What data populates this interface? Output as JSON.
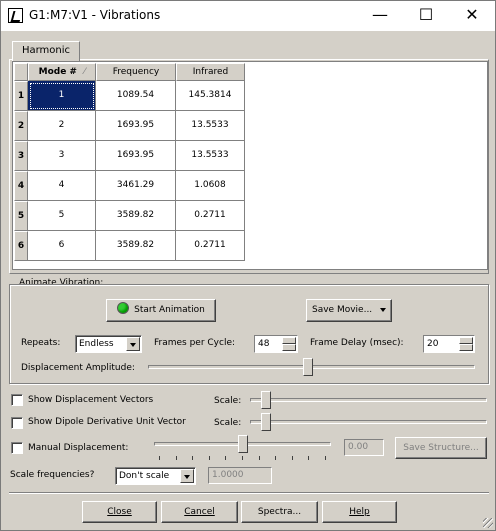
{
  "window": {
    "title": "G1:M7:V1 - Vibrations",
    "minimize": "—",
    "maximize": "☐",
    "close": "✕"
  },
  "tab": {
    "label": "Harmonic"
  },
  "table": {
    "headers": [
      "Mode #",
      "Frequency",
      "Infrared"
    ],
    "sort_indicator": "⁄",
    "rows": [
      {
        "num": "1",
        "mode": "1",
        "frequency": "1089.54",
        "infrared": "145.3814"
      },
      {
        "num": "2",
        "mode": "2",
        "frequency": "1693.95",
        "infrared": "13.5533"
      },
      {
        "num": "3",
        "mode": "3",
        "frequency": "1693.95",
        "infrared": "13.5533"
      },
      {
        "num": "4",
        "mode": "4",
        "frequency": "3461.29",
        "infrared": "1.0608"
      },
      {
        "num": "5",
        "mode": "5",
        "frequency": "3589.82",
        "infrared": "0.2711"
      },
      {
        "num": "6",
        "mode": "6",
        "frequency": "3589.82",
        "infrared": "0.2711"
      }
    ],
    "selected_row": 1
  },
  "animate": {
    "group_label": "Animate Vibration:",
    "start_button": "Start Animation",
    "save_movie_button": "Save Movie...",
    "repeats_label": "Repeats:",
    "repeats_value": "Endless",
    "frames_label": "Frames per Cycle:",
    "frames_value": "48",
    "delay_label": "Frame Delay (msec):",
    "delay_value": "20",
    "amplitude_label": "Displacement Amplitude:",
    "amplitude_level": 0.49
  },
  "options": {
    "show_vectors_label": "Show Displacement Vectors",
    "show_vectors_checked": false,
    "show_dipole_label": "Show Dipole Derivative Unit Vector",
    "show_dipole_checked": false,
    "scale_label": "Scale:",
    "vectors_scale_level": 0.05,
    "dipole_scale_level": 0.05,
    "manual_label": "Manual Displacement:",
    "manual_checked": false,
    "manual_level": 0.5,
    "manual_value": "0.00",
    "save_structure_button": "Save Structure...",
    "scale_freq_label": "Scale frequencies?",
    "scale_freq_value": "Don't scale",
    "scale_freq_factor": "1.0000"
  },
  "footer": {
    "close": "Close",
    "cancel": "Cancel",
    "spectra": "Spectra...",
    "help": "Help"
  }
}
